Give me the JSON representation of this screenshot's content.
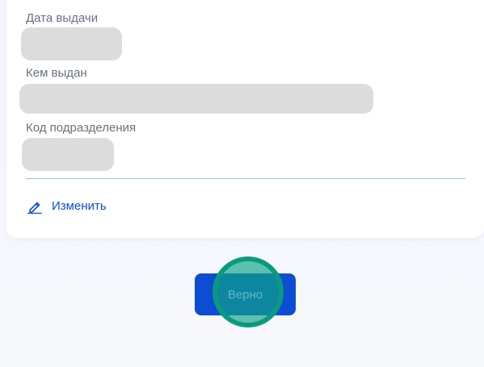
{
  "passport": {
    "issue_date": {
      "label": "Дата выдачи",
      "value": ""
    },
    "issued_by": {
      "label": "Кем выдан",
      "value": ""
    },
    "division_code": {
      "label": "Код подразделения",
      "value": ""
    }
  },
  "actions": {
    "edit_label": "Изменить",
    "edit_icon": "pencil-icon",
    "confirm_label": "Верно"
  },
  "colors": {
    "accent": "#0d4cd3",
    "placeholder": "#dcdcdc",
    "label": "#66727f",
    "touch_indicator": "#0a9a7d"
  }
}
